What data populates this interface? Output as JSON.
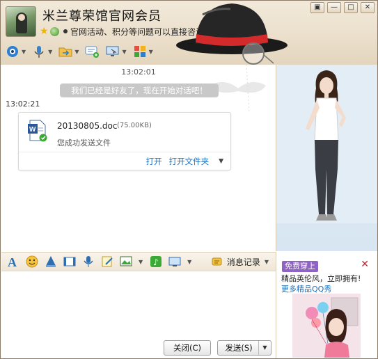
{
  "header": {
    "contact_name": "米兰尊荣馆官网会员",
    "signature": "官网活动、积分等问题可以直接咨询哦~~",
    "window_buttons": [
      "□",
      "—",
      "□",
      "✕"
    ]
  },
  "toolbar": {
    "items": [
      "video-call-icon",
      "voice-call-icon",
      "send-file-icon",
      "sms-icon",
      "remote-desktop-icon",
      "apps-icon"
    ]
  },
  "chat": {
    "time_top": "13:02:01",
    "system_message": "我们已经是好友了，现在开始对话吧！",
    "time_left": "13:02:21",
    "file": {
      "name": "20130805.doc",
      "size": "(75.00KB)",
      "status": "您成功发送文件",
      "open": "打开",
      "open_folder": "打开文件夹"
    }
  },
  "input_toolbar": {
    "history_label": "消息记录"
  },
  "buttons": {
    "close": "关闭(C)",
    "send": "发送(S)"
  },
  "ad": {
    "badge": "免费穿上",
    "close": "✕",
    "line1": "精品英伦风，立即拥有!",
    "line2": "更多精品QQ秀"
  },
  "colors": {
    "header_bg": "#ebdfcb",
    "link": "#1a6fbf",
    "ad_badge": "#8f63c2",
    "ad_close": "#c0262c"
  }
}
